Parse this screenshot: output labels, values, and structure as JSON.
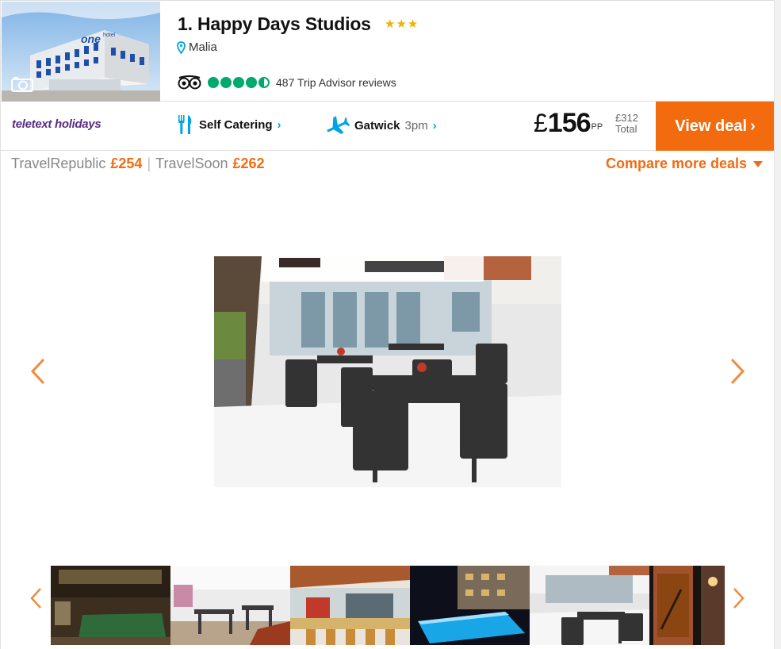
{
  "hotel": {
    "title": "1. Happy Days Studios",
    "stars": "★★★",
    "location": "Malia",
    "tripadvisor_rating": 4.5,
    "reviews_text": "487 Trip Advisor reviews"
  },
  "deal": {
    "provider": "teletext holidays",
    "board": "Self Catering",
    "airport": "Gatwick",
    "flight_time": "3pm",
    "currency": "£",
    "price_pp": "156",
    "pp_label": "PP",
    "total_price": "£312",
    "total_label": "Total",
    "cta": "View deal"
  },
  "other_deals": [
    {
      "provider": "TravelRepublic",
      "price": "£254"
    },
    {
      "provider": "TravelSoon",
      "price": "£262"
    }
  ],
  "compare_label": "Compare more deals",
  "colors": {
    "accent": "#f26b0f",
    "tripadvisor": "#00aa6c",
    "link_blue": "#00a4e4",
    "provider_purple": "#5a2d82",
    "stars": "#f3b000"
  },
  "icons": {
    "camera": "camera-icon",
    "pin": "map-pin-icon",
    "owl": "tripadvisor-owl-icon",
    "cutlery": "cutlery-icon",
    "plane": "plane-icon",
    "caret": "caret-down-icon",
    "prev": "chevron-left-icon",
    "next": "chevron-right-icon"
  },
  "gallery": {
    "thumbnails": [
      "pool-table",
      "dining-area",
      "bar",
      "pool-night",
      "terrace",
      "exterior-night"
    ]
  }
}
